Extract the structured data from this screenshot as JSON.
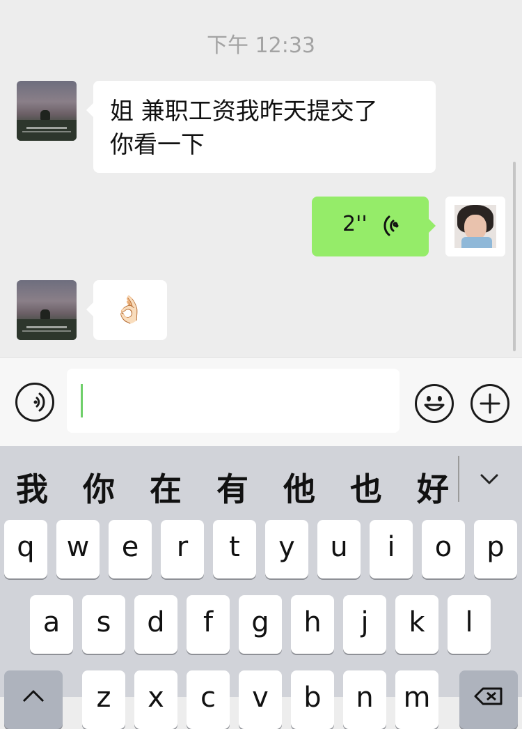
{
  "chat": {
    "timestamp": "下午 12:33",
    "messages": [
      {
        "from": "other",
        "type": "text",
        "text_line1": "姐 兼职工资我昨天提交了",
        "text_line2": "你看一下"
      },
      {
        "from": "self",
        "type": "voice",
        "duration": "2''"
      },
      {
        "from": "other",
        "type": "emoji",
        "emoji": "👌🏻"
      }
    ]
  },
  "input_bar": {
    "voice_button_icon": "voice-mode-icon",
    "text_value": "",
    "emoji_button_icon": "smiley-face-icon",
    "more_button_icon": "plus-icon"
  },
  "keyboard": {
    "candidates": [
      "我",
      "你",
      "在",
      "有",
      "他",
      "也",
      "好"
    ],
    "collapse_icon": "chevron-down-icon",
    "row1": [
      "q",
      "w",
      "e",
      "r",
      "t",
      "y",
      "u",
      "i",
      "o",
      "p"
    ],
    "row2": [
      "a",
      "s",
      "d",
      "f",
      "g",
      "h",
      "j",
      "k",
      "l"
    ],
    "row3": [
      "z",
      "x",
      "c",
      "v",
      "b",
      "n",
      "m"
    ],
    "shift_icon": "shift-arrow-icon",
    "delete_icon": "backspace-icon"
  },
  "colors": {
    "background": "#ededed",
    "incoming_bubble": "#ffffff",
    "outgoing_bubble": "#95ec69",
    "keyboard_bg": "#d1d3d9"
  }
}
